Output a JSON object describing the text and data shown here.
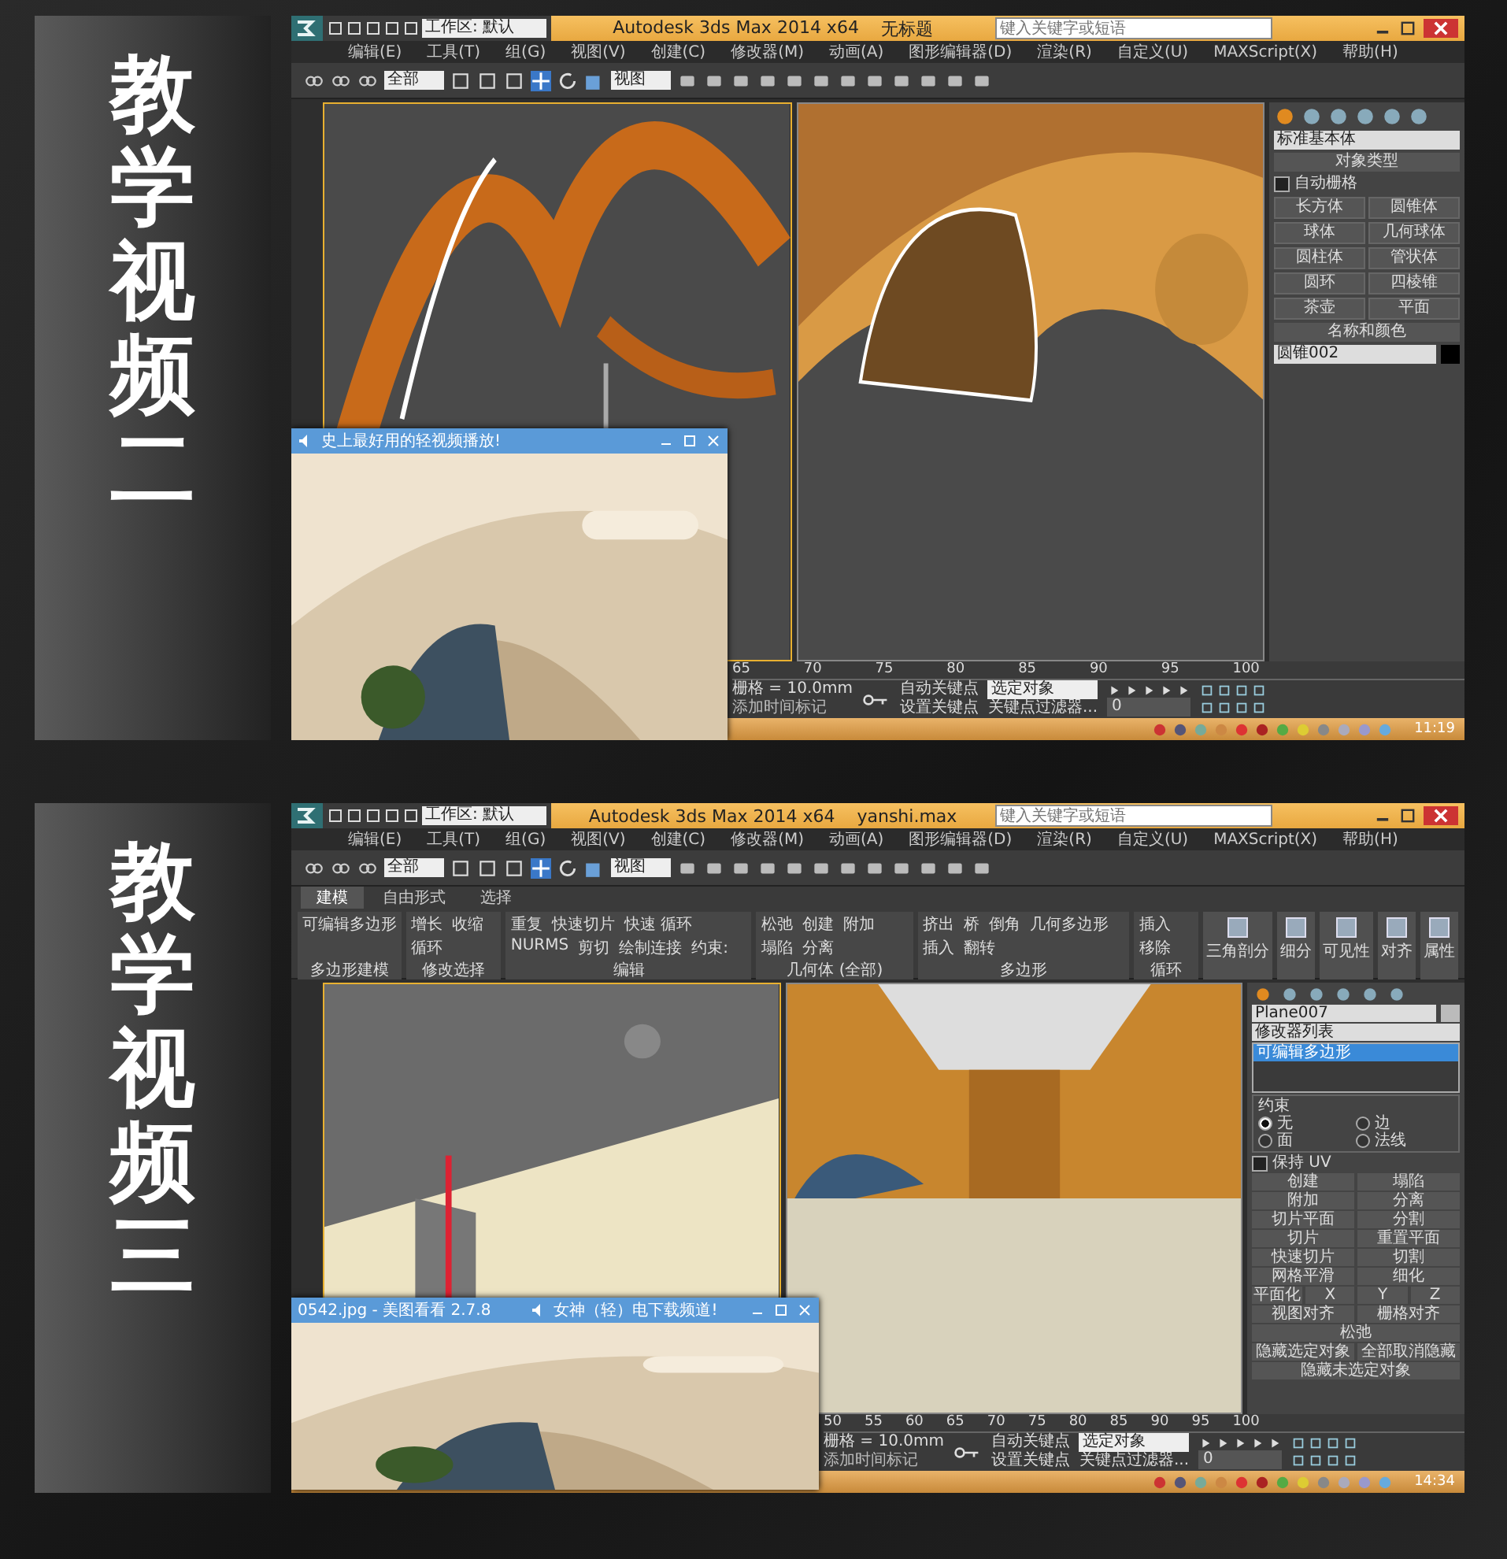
{
  "sections": [
    {
      "label": "教学视频二",
      "app": {
        "kind": "create",
        "title": "Autodesk 3ds Max  2014 x64",
        "file": "无标题",
        "workspace": "工作区: 默认",
        "search_placeholder": "键入关键字或短语",
        "menu": [
          "编辑(E)",
          "工具(T)",
          "组(G)",
          "视图(V)",
          "创建(C)",
          "修改器(M)",
          "动画(A)",
          "图形编辑器(D)",
          "渲染(R)",
          "自定义(U)",
          "MAXScript(X)",
          "帮助(H)"
        ],
        "toolbar": {
          "filter": "全部",
          "coords": "视图"
        },
        "command_panel": {
          "dropdown": "标准基本体",
          "rollout": "对象类型",
          "checkbox": {
            "label": "自动栅格",
            "checked": false
          },
          "buttons": [
            "长方体",
            "圆锥体",
            "球体",
            "几何球体",
            "圆柱体",
            "管状体",
            "圆环",
            "四棱锥",
            "茶壶",
            "平面"
          ],
          "name_rollout": "名称和颜色",
          "name": "圆锥002"
        },
        "popup": {
          "title": "史上最好用的轻视频播放!"
        },
        "status": {
          "ticks": [
            "65",
            "70",
            "75",
            "80",
            "85",
            "90",
            "95",
            "100"
          ],
          "grid": "栅格 = 10.0mm",
          "add_tag": "添加时间标记",
          "auto_key": "自动关键点",
          "set_key": "设置关键点",
          "key_mode": "选定对象",
          "filter": "关键点过滤器...",
          "frame": "0"
        },
        "clock": "11:19"
      }
    },
    {
      "label": "教学视频三",
      "app": {
        "kind": "modify",
        "title": "Autodesk 3ds Max  2014 x64",
        "file": "yanshi.max",
        "workspace": "工作区: 默认",
        "search_placeholder": "键入关键字或短语",
        "menu": [
          "编辑(E)",
          "工具(T)",
          "组(G)",
          "视图(V)",
          "创建(C)",
          "修改器(M)",
          "动画(A)",
          "图形编辑器(D)",
          "渲染(R)",
          "自定义(U)",
          "MAXScript(X)",
          "帮助(H)"
        ],
        "toolbar": {
          "filter": "全部",
          "coords": "视图"
        },
        "ribbon": {
          "tabs": [
            {
              "label": "建模",
              "selected": true
            },
            {
              "label": "自由形式",
              "selected": false
            },
            {
              "label": "选择",
              "selected": false
            }
          ],
          "groups": [
            {
              "name": "多边形建模",
              "items": [
                "可编辑多边形"
              ]
            },
            {
              "name": "修改选择",
              "items": [
                "增长",
                "收缩",
                "循环"
              ]
            },
            {
              "name": "编辑",
              "items": [
                "重复",
                "快速切片",
                "快速 循环",
                "NURMS",
                "剪切",
                "绘制连接",
                "约束:"
              ]
            },
            {
              "name": "几何体 (全部)",
              "items": [
                "松弛",
                "创建",
                "附加",
                "塌陷",
                "分离"
              ]
            },
            {
              "name": "多边形",
              "items": [
                "挤出",
                "桥",
                "倒角",
                "几何多边形",
                "插入",
                "翻转"
              ]
            },
            {
              "name": "循环",
              "items": [
                "插入",
                "移除"
              ]
            }
          ],
          "big_buttons": [
            "三角剖分",
            "细分",
            "可见性",
            "对齐",
            "属性"
          ]
        },
        "command_panel": {
          "name": "Plane007",
          "modifier_list": "修改器列表",
          "stack": [
            {
              "label": "可编辑多边形",
              "selected": true
            }
          ],
          "constraint": {
            "title": "约束",
            "options": [
              {
                "label": "无",
                "selected": true
              },
              {
                "label": "边",
                "selected": false
              },
              {
                "label": "面",
                "selected": false
              },
              {
                "label": "法线",
                "selected": false
              }
            ]
          },
          "checkbox": {
            "label": "保持 UV",
            "checked": false
          },
          "button_rows": [
            [
              "创建",
              "塌陷"
            ],
            [
              "附加",
              "分离"
            ],
            [
              "切片平面",
              "分割"
            ],
            [
              "切片",
              "重置平面"
            ],
            [
              "快速切片",
              "切割"
            ],
            [
              "网格平滑",
              "细化"
            ],
            [
              "平面化",
              "X",
              "Y",
              "Z"
            ],
            [
              "视图对齐",
              "栅格对齐"
            ],
            [
              "松弛"
            ],
            [
              "隐藏选定对象",
              "全部取消隐藏"
            ],
            [
              "隐藏未选定对象"
            ]
          ]
        },
        "popup": {
          "left_title": "0542.jpg - 美图看看 2.7.8",
          "title": "女神（轻）电下载频道!"
        },
        "status": {
          "ticks": [
            "50",
            "55",
            "60",
            "65",
            "70",
            "75",
            "80",
            "85",
            "90",
            "95",
            "100"
          ],
          "grid": "栅格 = 10.0mm",
          "add_tag": "添加时间标记",
          "auto_key": "自动关键点",
          "set_key": "设置关键点",
          "key_mode": "选定对象",
          "filter": "关键点过滤器...",
          "frame": "0"
        },
        "clock": "14:34"
      }
    }
  ]
}
